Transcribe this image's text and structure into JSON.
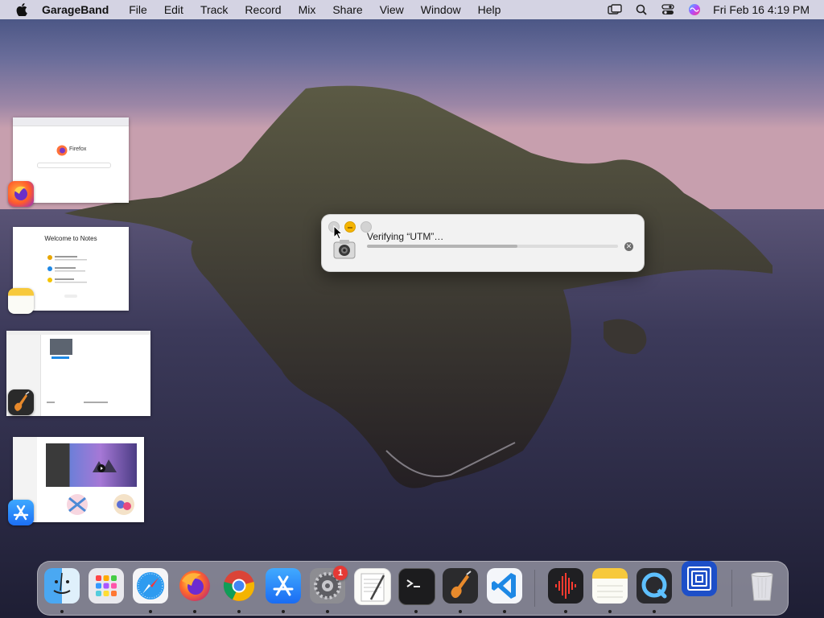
{
  "menubar": {
    "app_name": "GarageBand",
    "items": [
      "File",
      "Edit",
      "Track",
      "Record",
      "Mix",
      "Share",
      "View",
      "Window",
      "Help"
    ],
    "clock": "Fri Feb 16  4:19 PM",
    "status_icons": [
      "screen-mirroring-icon",
      "search-icon",
      "control-center-icon",
      "siri-icon"
    ]
  },
  "app_switcher": {
    "windows": [
      {
        "app": "firefox",
        "brand_text": "Firefox"
      },
      {
        "app": "notes",
        "heading": "Welcome to Notes"
      },
      {
        "app": "garageband"
      },
      {
        "app": "app-store"
      }
    ]
  },
  "dialog": {
    "title": "Verifying “UTM”…",
    "progress": 0.6
  },
  "dock": {
    "items": [
      "finder",
      "launchpad",
      "safari",
      "firefox",
      "chrome",
      "app-store",
      "system-preferences",
      "textedit",
      "terminal",
      "garageband",
      "vscode",
      "audio-recorder",
      "notes",
      "quicktime",
      "utm",
      "trash"
    ],
    "system_preferences_badge": "1"
  },
  "colors": {
    "accent_blue": "#1e88e5",
    "badge_red": "#e53935",
    "traffic_yellow": "#f5b400"
  }
}
